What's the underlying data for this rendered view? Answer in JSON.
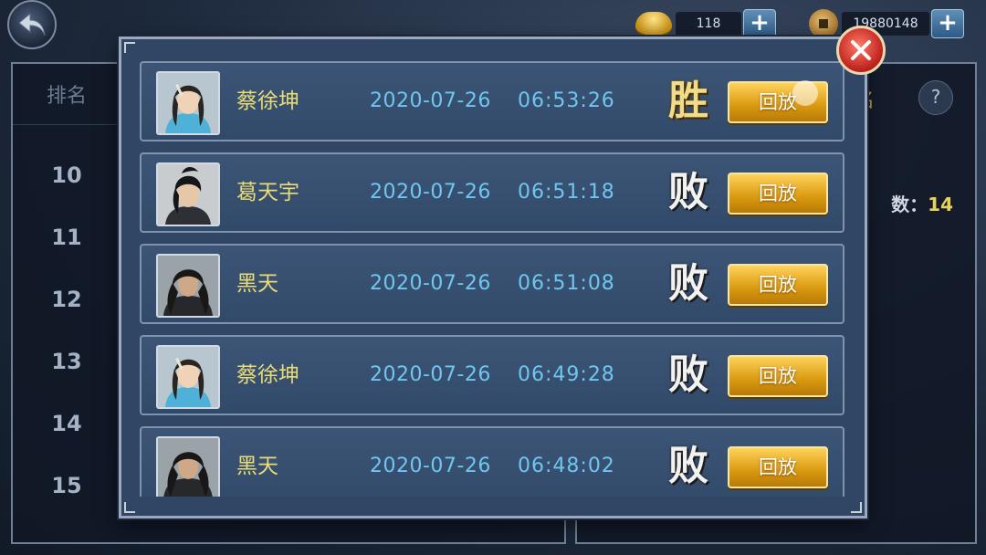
{
  "currency": {
    "ingot_amount": "118",
    "coin_amount": "19880148",
    "plus_label": "+"
  },
  "leaderboard": {
    "header": "排名",
    "ranks": [
      "10",
      "11",
      "12",
      "13",
      "14",
      "15"
    ]
  },
  "right_panel": {
    "title_peek": "名",
    "help_label": "?",
    "wins_label": "数：",
    "wins_value": "14"
  },
  "battle_log": {
    "records": [
      {
        "name": "蔡徐坤",
        "date": "2020-07-26",
        "time": "06:53:26",
        "result": "胜",
        "outcome": "win",
        "replay_label": "回放",
        "avatar": "white-robed-swordsman"
      },
      {
        "name": "葛天宇",
        "date": "2020-07-26",
        "time": "06:51:18",
        "result": "败",
        "outcome": "loss",
        "replay_label": "回放",
        "avatar": "dark-haired-swordsman"
      },
      {
        "name": "黑天",
        "date": "2020-07-26",
        "time": "06:51:08",
        "result": "败",
        "outcome": "loss",
        "replay_label": "回放",
        "avatar": "long-haired-warrior"
      },
      {
        "name": "蔡徐坤",
        "date": "2020-07-26",
        "time": "06:49:28",
        "result": "败",
        "outcome": "loss",
        "replay_label": "回放",
        "avatar": "white-robed-swordsman"
      },
      {
        "name": "黑天",
        "date": "2020-07-26",
        "time": "06:48:02",
        "result": "败",
        "outcome": "loss",
        "replay_label": "回放",
        "avatar": "long-haired-warrior"
      }
    ]
  },
  "icons": {
    "back": "back-arrow-icon",
    "close": "close-x-icon",
    "ingot": "gold-ingot-icon",
    "coin": "copper-coin-icon"
  },
  "colors": {
    "name": "#e9dc75",
    "timestamp": "#6fc6ee",
    "win": "#f1dc8a",
    "loss": "#f2f2f2",
    "replay_button": "#d9990f",
    "close_button": "#c1261e"
  }
}
